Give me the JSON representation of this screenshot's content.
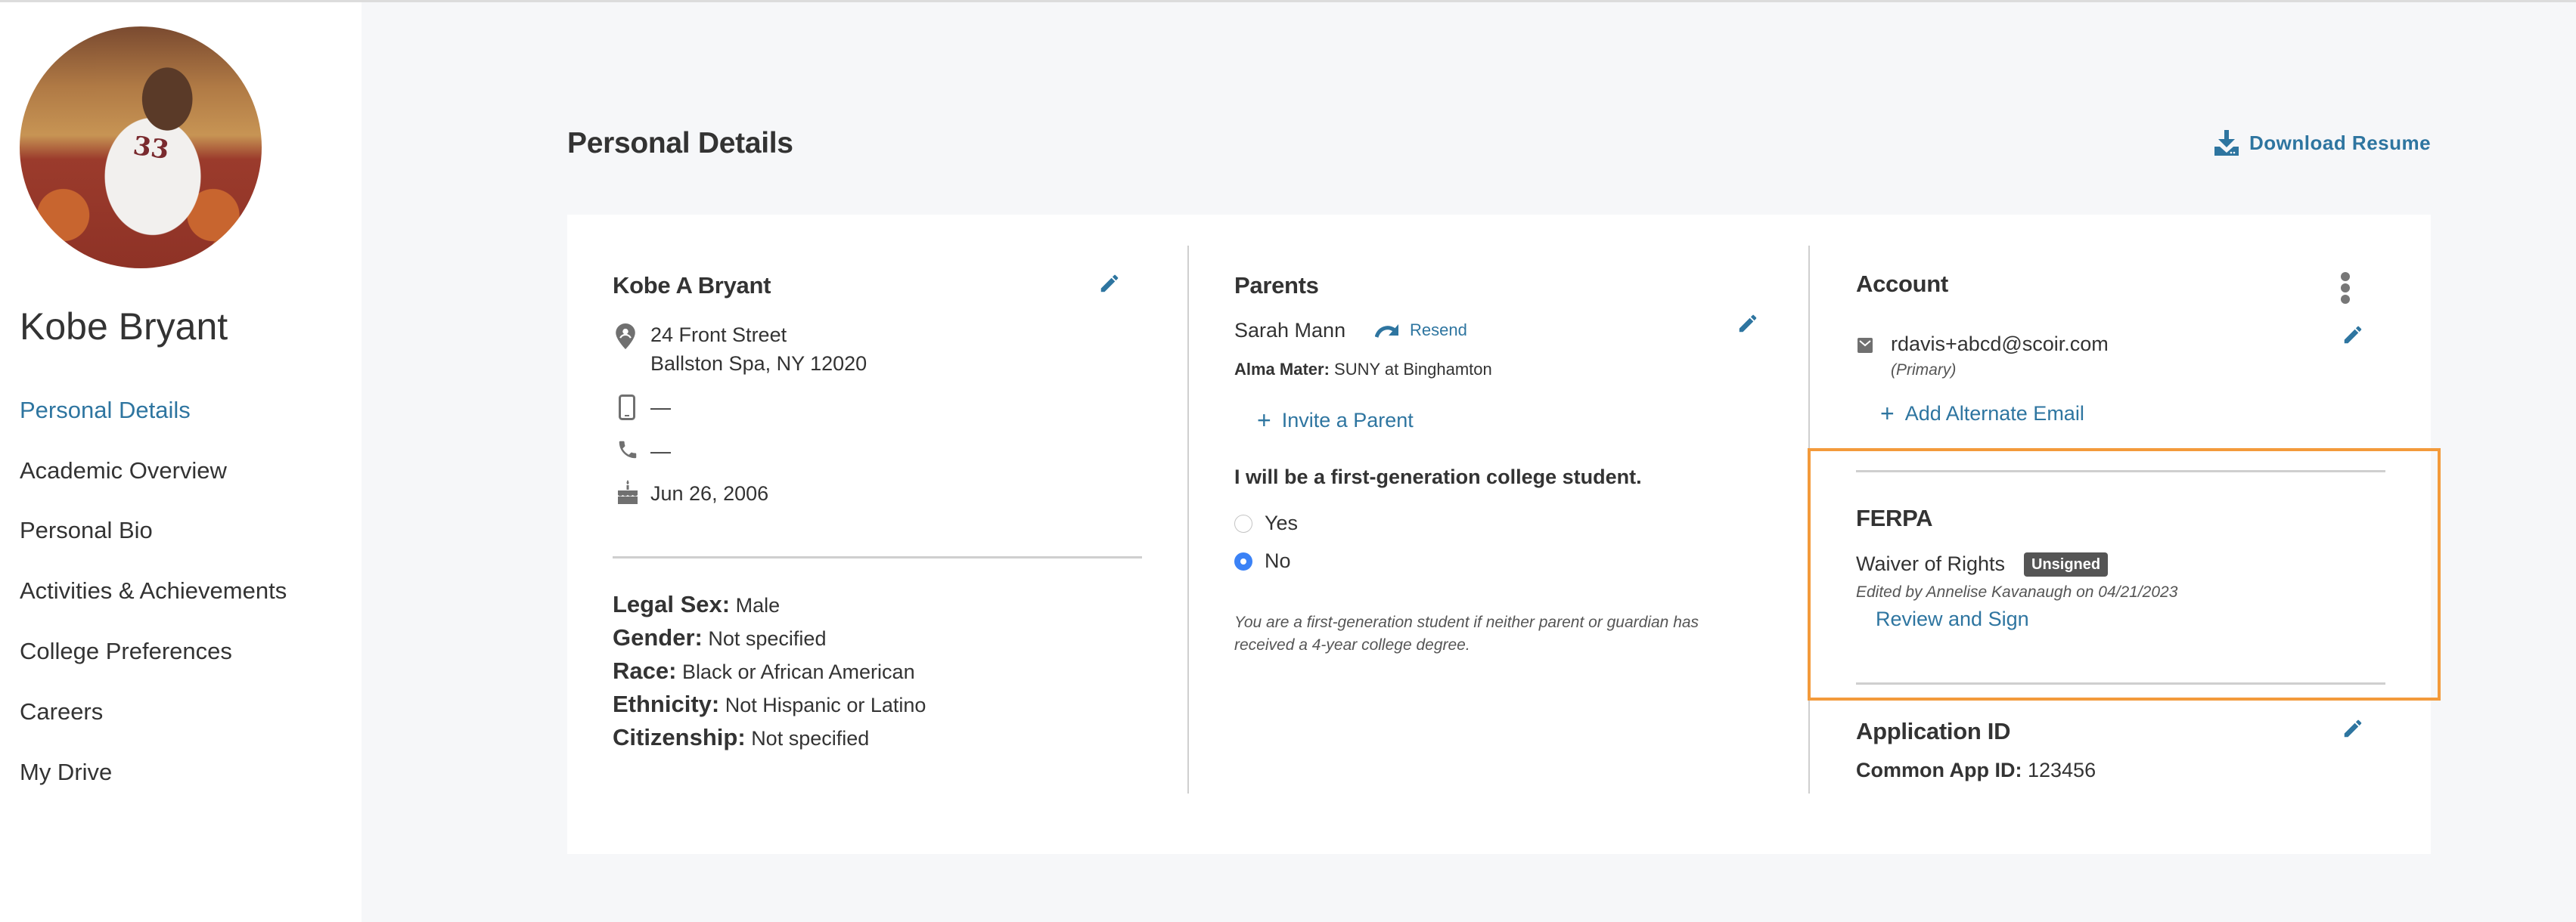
{
  "colors": {
    "accent": "#2e75a0",
    "text": "#333333",
    "radio_selected": "#3b82f6",
    "highlight": "#f39a3b",
    "badge_bg": "#555555",
    "page_bg": "#f6f7f9"
  },
  "sidebar": {
    "student_name": "Kobe Bryant",
    "avatar_alt": "Student profile photo",
    "avatar_jersey": "33",
    "nav": [
      {
        "label": "Personal Details",
        "active": true
      },
      {
        "label": "Academic Overview",
        "active": false
      },
      {
        "label": "Personal Bio",
        "active": false
      },
      {
        "label": "Activities & Achievements",
        "active": false
      },
      {
        "label": "College Preferences",
        "active": false
      },
      {
        "label": "Careers",
        "active": false
      },
      {
        "label": "My Drive",
        "active": false
      }
    ]
  },
  "header": {
    "title": "Personal Details",
    "download_label": "Download Resume",
    "download_icon": "download-icon"
  },
  "profile": {
    "full_name": "Kobe A Bryant",
    "address_line1": "24 Front Street",
    "address_line2": "Ballston Spa, NY 12020",
    "mobile": "—",
    "phone": "—",
    "birthday": "Jun 26, 2006",
    "demographics": [
      {
        "label": "Legal Sex:",
        "value": "Male"
      },
      {
        "label": "Gender:",
        "value": "Not specified"
      },
      {
        "label": "Race:",
        "value": "Black or African American"
      },
      {
        "label": "Ethnicity:",
        "value": "Not Hispanic or Latino"
      },
      {
        "label": "Citizenship:",
        "value": "Not specified"
      }
    ]
  },
  "parents": {
    "heading": "Parents",
    "parent_name": "Sarah Mann",
    "resend_label": "Resend",
    "alma_mater_label": "Alma Mater:",
    "alma_mater_value": "SUNY at Binghamton",
    "invite_label": "Invite a Parent",
    "first_gen_question": "I will be a first-generation college student.",
    "options": [
      {
        "label": "Yes",
        "selected": false
      },
      {
        "label": "No",
        "selected": true
      }
    ],
    "footnote_line1": "You are a first-generation student if neither parent or guardian has",
    "footnote_line2": "received a 4-year college degree."
  },
  "account": {
    "heading": "Account",
    "email": "rdavis+abcd@scoir.com",
    "email_note": "(Primary)",
    "add_email_label": "Add Alternate Email"
  },
  "ferpa": {
    "heading": "FERPA",
    "document": "Waiver of Rights",
    "status": "Unsigned",
    "edited_note": "Edited by Annelise Kavanaugh on 04/21/2023",
    "action_label": "Review and Sign"
  },
  "application_id": {
    "heading": "Application ID",
    "label": "Common App ID:",
    "value": "123456"
  }
}
